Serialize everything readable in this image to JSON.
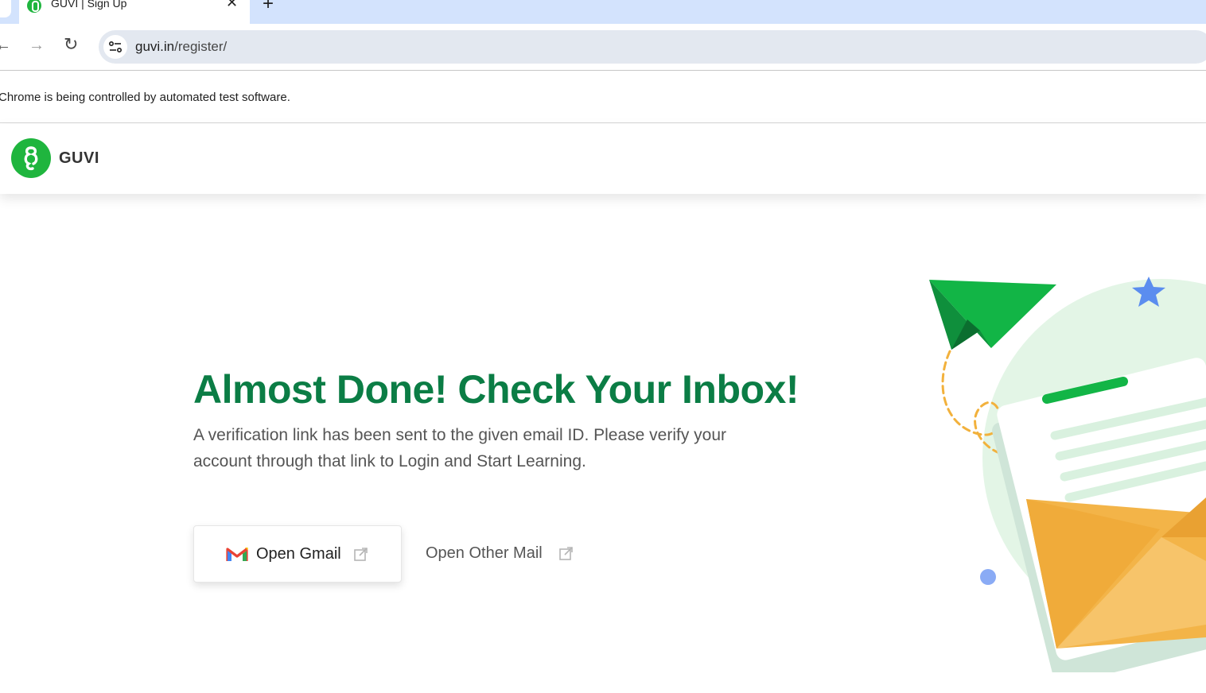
{
  "browser": {
    "tab_edge_glyph": "✓",
    "tab_title": "GUVI | Sign Up",
    "close_glyph": "✕",
    "new_tab_glyph": "+",
    "back_glyph": "←",
    "forward_glyph": "→",
    "reload_glyph": "↻",
    "url_host": "guvi.in",
    "url_path": "/register/",
    "infobar_text": "Chrome is being controlled by automated test software."
  },
  "site": {
    "logo_text": "GUVI",
    "brand_color": "#1fb53e",
    "heading_color": "#0b7d45"
  },
  "main": {
    "headline": "Almost Done! Check Your Inbox!",
    "subtext": "A verification link has been sent to the given email ID. Please verify your account through that link to Login and Start Learning.",
    "gmail_button_label": "Open Gmail",
    "other_mail_label": "Open Other Mail"
  },
  "icons": {
    "gmail": "gmail-icon",
    "external": "external-link-icon",
    "site_info": "tune-icon",
    "illustration": "paper-plane-envelope-illustration"
  }
}
